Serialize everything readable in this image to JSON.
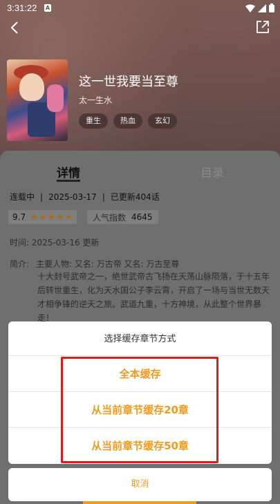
{
  "status_bar": {
    "time": "3:31:22",
    "notif_letter": "A"
  },
  "book": {
    "title": "这一世我要当至尊",
    "author": "太一生水",
    "tags": [
      "重生",
      "热血",
      "玄幻"
    ]
  },
  "tabs": {
    "detail": "详情",
    "catalog": "目录"
  },
  "meta": {
    "status": "连载中",
    "date": "2025-03-17",
    "updated": "已更新404话",
    "rating": "9.7",
    "stars": 5,
    "popularity_label": "人气指数",
    "popularity_value": "4645",
    "time_line": "时间:  2025-03-16 更新"
  },
  "intro": {
    "label": "简介:",
    "names": "主要人物: 又名: 万古帝  又名: 万古至尊",
    "body": "十大封号武帝之一，绝世武帝古飞扬在天荡山脉陨落，于十五年后转世重生，化为天水国公子李云霄，开启了一场与当世无数天才相争锋的逆天之旅。武道九重，十方神境，从此整个世界暴走！"
  },
  "dialog": {
    "title": "选择缓存章节方式",
    "options": [
      "全本缓存",
      "从当前章节缓存20章",
      "从当前章节缓存50章"
    ],
    "cancel": "取消"
  },
  "colors": {
    "accent": "#f19a1e",
    "highlight": "#e11a1a"
  }
}
